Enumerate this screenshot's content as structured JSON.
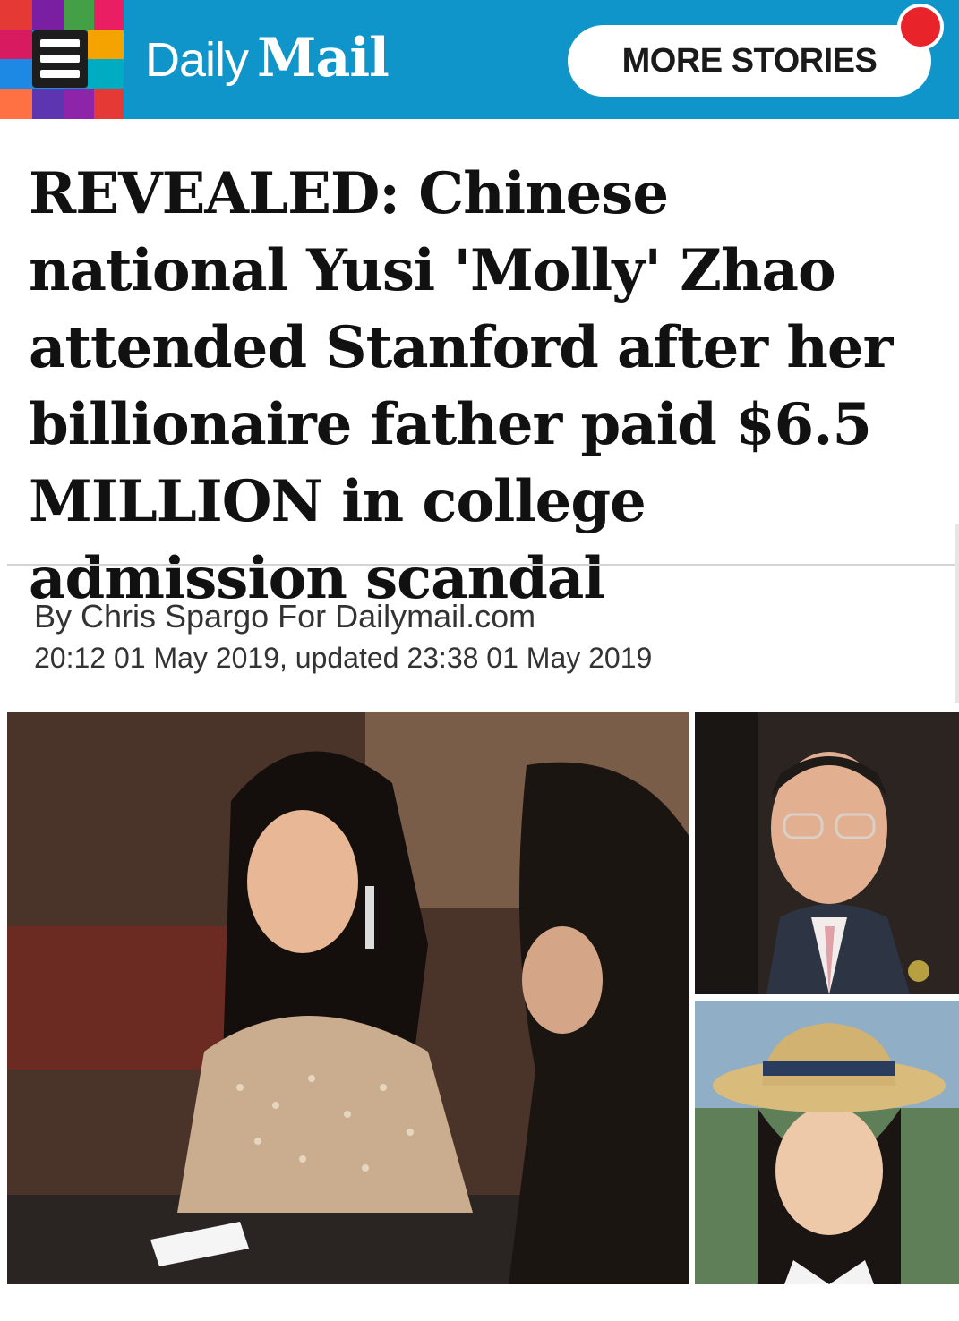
{
  "header": {
    "logo_daily": "Daily",
    "logo_mail": "Mail",
    "more_stories_label": "MORE STORIES",
    "menu_tile_colors": [
      "#e53935",
      "#7b1fa2",
      "#43a047",
      "#f4a300",
      "#1e88e5",
      "#d81b60",
      "#ff7043",
      "#5e35b1",
      "#8e24aa",
      "#00acc1"
    ],
    "brand_color": "#0f95c9",
    "notification_color": "#e8232a"
  },
  "article": {
    "headline": "REVEALED: Chinese national Yusi 'Molly' Zhao attended Stanford after her billionaire father paid $6.5 MILLION in college admission scandal",
    "byline": "By Chris Spargo For Dailymail.com",
    "dateline": "20:12 01 May 2019, updated 23:38 01 May 2019"
  },
  "images": {
    "main": "photo-young-woman-sequin-dress",
    "side_top": "photo-man-glasses-suit",
    "side_bottom": "photo-girl-straw-boater-hat"
  }
}
